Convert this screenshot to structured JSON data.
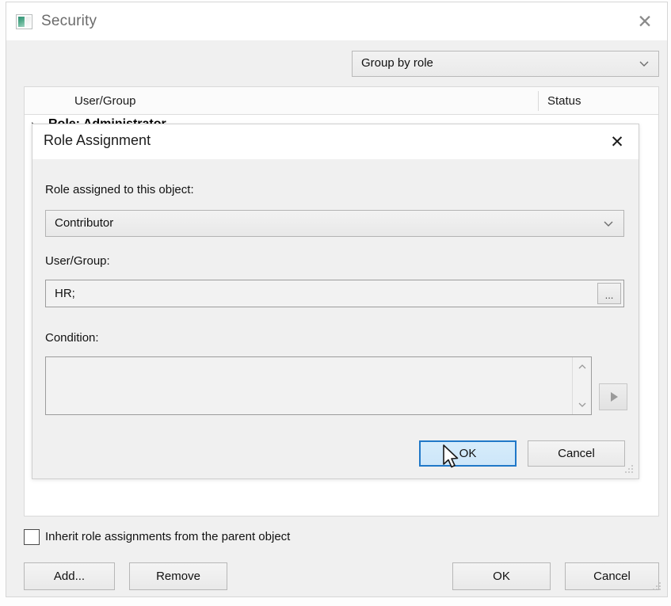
{
  "window": {
    "title": "Security",
    "icon": "app-window-icon",
    "close_label": "✕",
    "group_by": {
      "value": "Group by role",
      "arrow": "chevron-down-icon"
    },
    "table": {
      "columns": [
        "User/Group",
        "Status"
      ],
      "groups": [
        {
          "label": "Role: Administrator",
          "expander": "collapse-triangle-icon"
        }
      ]
    },
    "inherit_checkbox": {
      "label": "Inherit role assignments from the parent object",
      "checked": false
    },
    "buttons": {
      "add": "Add...",
      "remove": "Remove",
      "ok": "OK",
      "cancel": "Cancel"
    }
  },
  "modal": {
    "title": "Role Assignment",
    "close_label": "✕",
    "fields": {
      "role_label": "Role assigned to this object:",
      "role_value": "Contributor",
      "role_arrow": "chevron-down-icon",
      "usergroup_label": "User/Group:",
      "usergroup_value": "HR;",
      "browse_label": "...",
      "condition_label": "Condition:",
      "condition_value": "",
      "scroll_up": "⌃",
      "scroll_down": "⌄",
      "run_icon": "play-triangle-icon"
    },
    "buttons": {
      "ok": "OK",
      "cancel": "Cancel"
    }
  },
  "colors": {
    "accent": "#2078c8",
    "ok_fill": "#d6ecfb",
    "window_bg": "#f0f0f0",
    "icon_green": "#2f8f74"
  }
}
